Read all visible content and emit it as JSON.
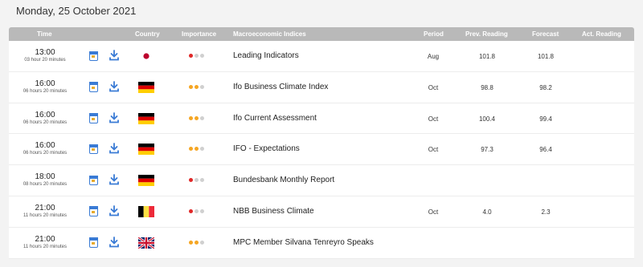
{
  "page_title": "Monday, 25 October 2021",
  "columns": {
    "time": "Time",
    "country": "Country",
    "importance": "Importance",
    "indicator": "Macroeconomic Indices",
    "period": "Period",
    "prev": "Prev. Reading",
    "forecast": "Forecast",
    "actual": "Act. Reading"
  },
  "colors": {
    "header_bg": "#b9b9b9",
    "dot_red": "#e02828",
    "dot_orange": "#f5a623",
    "dot_grey": "#d0d0d0",
    "icon_blue": "#3a7bd5"
  },
  "rows": [
    {
      "time": "13:00",
      "countdown": "03 hour 20 minutes",
      "country": "Japan",
      "flag": "japan-flag",
      "importance": 1,
      "importance_color": "red",
      "indicator": "Leading Indicators",
      "period": "Aug",
      "prev": "101.8",
      "forecast": "101.8",
      "actual": ""
    },
    {
      "time": "16:00",
      "countdown": "06 hours 20 minutes",
      "country": "Germany",
      "flag": "germany-flag",
      "importance": 2,
      "importance_color": "orange",
      "indicator": "Ifo Business Climate Index",
      "period": "Oct",
      "prev": "98.8",
      "forecast": "98.2",
      "actual": ""
    },
    {
      "time": "16:00",
      "countdown": "06 hours 20 minutes",
      "country": "Germany",
      "flag": "germany-flag",
      "importance": 2,
      "importance_color": "orange",
      "indicator": "Ifo Current Assessment",
      "period": "Oct",
      "prev": "100.4",
      "forecast": "99.4",
      "actual": ""
    },
    {
      "time": "16:00",
      "countdown": "06 hours 20 minutes",
      "country": "Germany",
      "flag": "germany-flag",
      "importance": 2,
      "importance_color": "orange",
      "indicator": "IFO - Expectations",
      "period": "Oct",
      "prev": "97.3",
      "forecast": "96.4",
      "actual": ""
    },
    {
      "time": "18:00",
      "countdown": "08 hours 20 minutes",
      "country": "Germany",
      "flag": "germany-flag",
      "importance": 1,
      "importance_color": "red",
      "indicator": "Bundesbank Monthly Report",
      "period": "",
      "prev": "",
      "forecast": "",
      "actual": ""
    },
    {
      "time": "21:00",
      "countdown": "11 hours 20 minutes",
      "country": "Belgium",
      "flag": "belgium-flag",
      "importance": 1,
      "importance_color": "red",
      "indicator": "NBB Business Climate",
      "period": "Oct",
      "prev": "4.0",
      "forecast": "2.3",
      "actual": ""
    },
    {
      "time": "21:00",
      "countdown": "11 hours 20 minutes",
      "country": "United Kingdom",
      "flag": "uk-flag",
      "importance": 2,
      "importance_color": "orange",
      "indicator": "MPC Member Silvana Tenreyro Speaks",
      "period": "",
      "prev": "",
      "forecast": "",
      "actual": ""
    }
  ]
}
